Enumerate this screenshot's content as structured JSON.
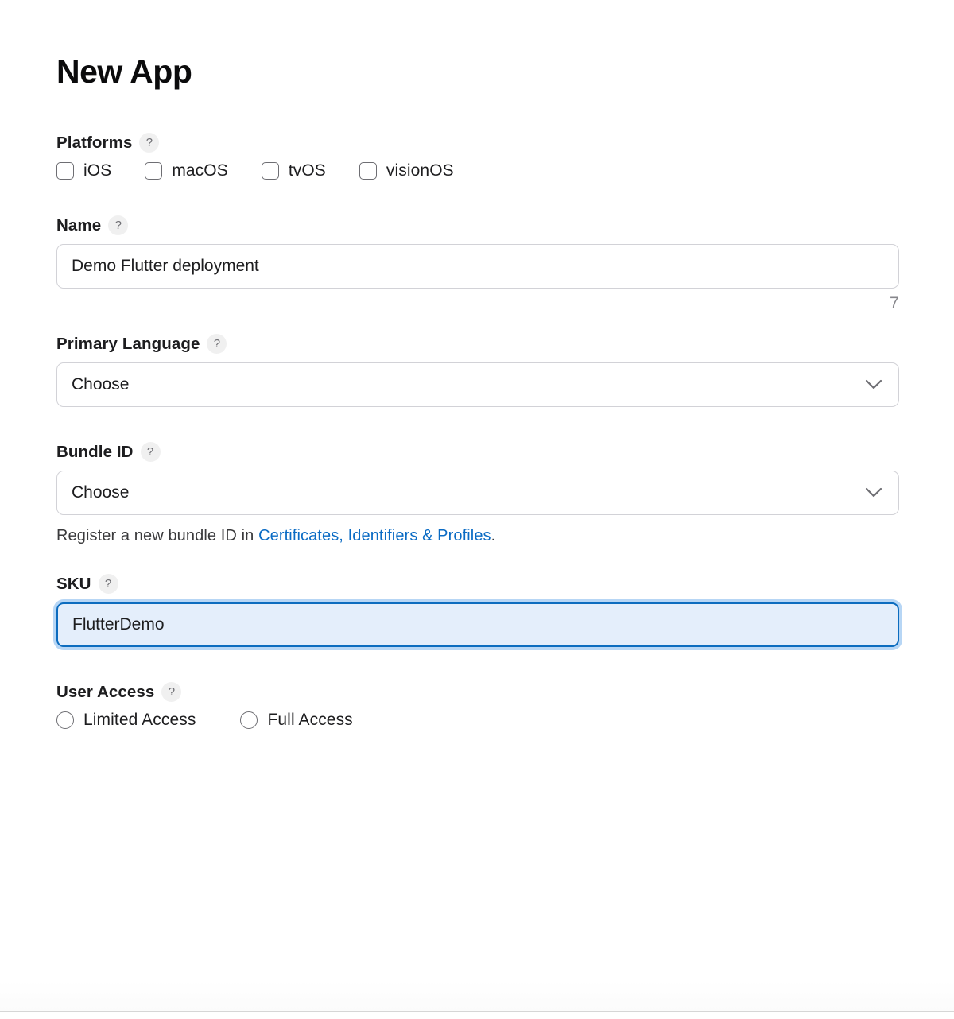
{
  "page": {
    "title": "New App"
  },
  "help_icon_glyph": "?",
  "platforms": {
    "label": "Platforms",
    "help": "?",
    "options": [
      {
        "label": "iOS",
        "checked": false
      },
      {
        "label": "macOS",
        "checked": false
      },
      {
        "label": "tvOS",
        "checked": false
      },
      {
        "label": "visionOS",
        "checked": false
      }
    ]
  },
  "name": {
    "label": "Name",
    "help": "?",
    "value": "Demo Flutter deployment",
    "placeholder": "",
    "counter": "7"
  },
  "primary_language": {
    "label": "Primary Language",
    "help": "?",
    "value": "Choose",
    "chevron_icon": "chevron-down-icon"
  },
  "bundle_id": {
    "label": "Bundle ID",
    "help": "?",
    "value": "Choose",
    "chevron_icon": "chevron-down-icon",
    "helper_prefix": "Register a new bundle ID in ",
    "helper_link": "Certificates, Identifiers & Profiles",
    "helper_suffix": "."
  },
  "sku": {
    "label": "SKU",
    "help": "?",
    "value": "FlutterDemo",
    "placeholder": "",
    "focused": true
  },
  "user_access": {
    "label": "User Access",
    "help": "?",
    "options": [
      {
        "label": "Limited Access",
        "selected": false
      },
      {
        "label": "Full Access",
        "selected": false
      }
    ]
  },
  "colors": {
    "focus_border": "#0c6cbf",
    "focus_fill": "#e4eefb",
    "focus_ring": "#b7d6f5",
    "link": "#0a6bc4",
    "border": "#d2d2d7",
    "muted_text": "#86868b",
    "text": "#1d1d1f"
  }
}
